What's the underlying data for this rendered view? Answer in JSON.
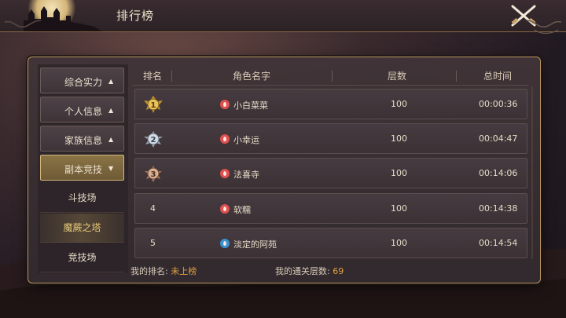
{
  "header": {
    "title": "排行榜"
  },
  "sidebar": {
    "categories": [
      {
        "label": "综合实力",
        "arrow": "▲"
      },
      {
        "label": "个人信息",
        "arrow": "▲"
      },
      {
        "label": "家族信息",
        "arrow": "▲"
      },
      {
        "label": "副本竞技",
        "arrow": "▼"
      }
    ],
    "sub_items": [
      {
        "label": "斗技场"
      },
      {
        "label": "魔蕨之塔"
      },
      {
        "label": "竞技场"
      }
    ]
  },
  "table": {
    "headers": {
      "rank": "排名",
      "name": "角色名字",
      "floors": "层数",
      "time": "总时间"
    },
    "rows": [
      {
        "rank": "1",
        "name": "小白菜菜",
        "floors": "100",
        "time": "00:00:36",
        "class_color": "#e05050"
      },
      {
        "rank": "2",
        "name": "小幸运",
        "floors": "100",
        "time": "00:04:47",
        "class_color": "#e05050"
      },
      {
        "rank": "3",
        "name": "法喜寺",
        "floors": "100",
        "time": "00:14:06",
        "class_color": "#e05050"
      },
      {
        "rank": "4",
        "name": "软糯",
        "floors": "100",
        "time": "00:14:38",
        "class_color": "#e05050"
      },
      {
        "rank": "5",
        "name": "淡定的阿苑",
        "floors": "100",
        "time": "00:14:54",
        "class_color": "#3a90d0"
      }
    ]
  },
  "footer": {
    "my_rank_label": "我的排名:",
    "my_rank_value": "未上榜",
    "my_floors_label": "我的通关层数:",
    "my_floors_value": "69"
  },
  "colors": {
    "accent_gold": "#e0a040",
    "frame": "#b89462",
    "active_tab": "#8a7446"
  },
  "icons": {
    "close": "crossed-swords-icon",
    "rank1": "gold-medal-icon",
    "rank2": "silver-medal-icon",
    "rank3": "bronze-medal-icon",
    "class": "class-flame-icon"
  }
}
